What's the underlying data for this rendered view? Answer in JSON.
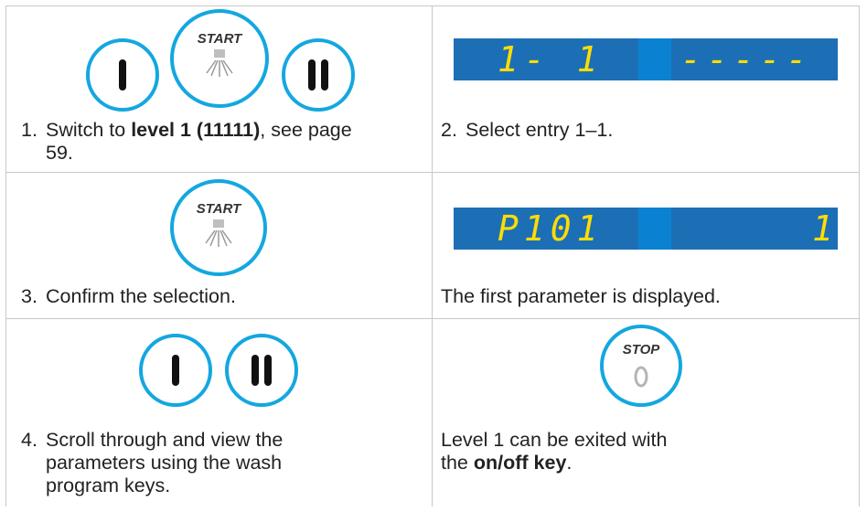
{
  "steps": {
    "step1": {
      "number": "1.",
      "pre": "Switch to ",
      "bold": "level 1 (11111)",
      "post": ", see page 59."
    },
    "step2": {
      "number": "2.",
      "text": "Select entry 1–1."
    },
    "step3": {
      "number": "3.",
      "text": "Confirm the selection."
    },
    "note3": {
      "text": "The first parameter is displayed."
    },
    "step4": {
      "number": "4.",
      "text": "Scroll through and view the parameters using the wash program keys."
    },
    "note4": {
      "pre": "Level 1 can be exited with the ",
      "bold": "on/off key",
      "post": "."
    }
  },
  "keys": {
    "start_label": "START",
    "stop_label": "STOP"
  },
  "displays": {
    "entry": {
      "left": "1- 1",
      "right": "-----"
    },
    "param": {
      "left": "P101",
      "right": "1"
    }
  },
  "colors": {
    "key_ring": "#14a7e0",
    "display_bg": "#1d6fb5",
    "segment": "#ffdd00"
  }
}
